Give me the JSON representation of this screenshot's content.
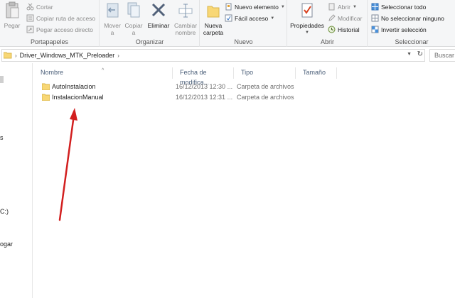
{
  "ribbon": {
    "clipboard": {
      "label": "Portapapeles",
      "paste": "Pegar",
      "cut": "Cortar",
      "copy_path": "Copiar ruta de acceso",
      "paste_shortcut": "Pegar acceso directo"
    },
    "organize": {
      "label": "Organizar",
      "move": "Mover",
      "move_sub": "a",
      "copy": "Copiar",
      "copy_sub": "a",
      "delete": "Eliminar",
      "rename_1": "Cambiar",
      "rename_2": "nombre"
    },
    "new": {
      "label": "Nuevo",
      "new_folder_1": "Nueva",
      "new_folder_2": "carpeta",
      "new_item": "Nuevo elemento",
      "easy_access": "Fácil acceso"
    },
    "open": {
      "label": "Abrir",
      "properties": "Propiedades",
      "open": "Abrir",
      "edit": "Modificar",
      "history": "Historial"
    },
    "select": {
      "label": "Seleccionar",
      "select_all": "Seleccionar todo",
      "select_none": "No seleccionar ninguno",
      "invert": "Invertir selección"
    }
  },
  "address": {
    "path": "Driver_Windows_MTK_Preloader",
    "search_placeholder": "Buscar"
  },
  "nav": {
    "fragments": [
      "s",
      "C:)",
      "ogar"
    ]
  },
  "columns": {
    "name": "Nombre",
    "date": "Fecha de modifica...",
    "type": "Tipo",
    "size": "Tamaño"
  },
  "files": [
    {
      "name": "AutoInstalacion",
      "date": "16/12/2013 12:30 ...",
      "type": "Carpeta de archivos"
    },
    {
      "name": "InstalacionManual",
      "date": "16/12/2013 12:31 ...",
      "type": "Carpeta de archivos"
    }
  ],
  "colors": {
    "folder": "#f8d775",
    "arrow": "#d21f1f",
    "column_header": "#4c607a"
  }
}
